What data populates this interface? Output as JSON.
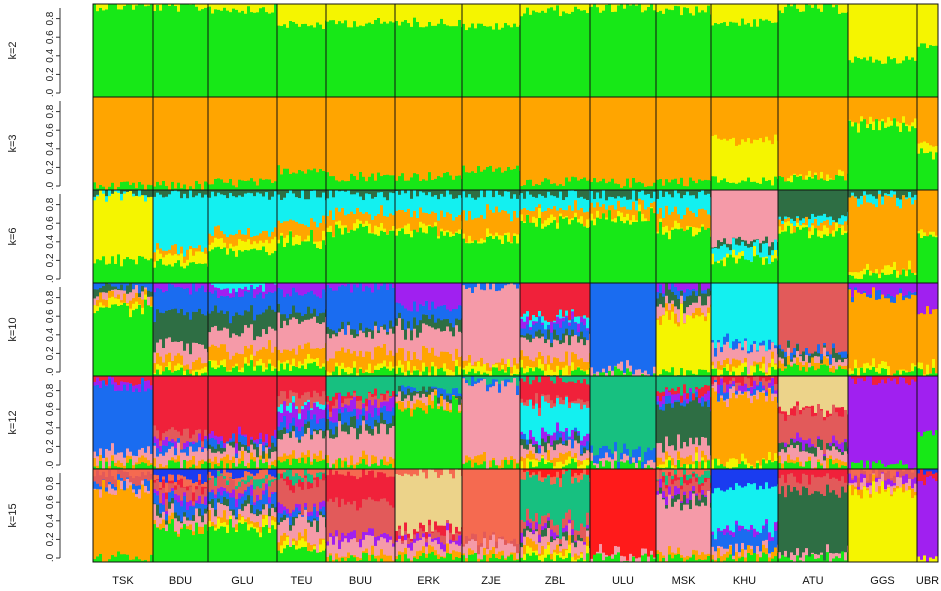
{
  "chart_data": {
    "type": "stacked-bar",
    "description_type": "admixture-structure-plot",
    "populations": [
      "TSK",
      "BDU",
      "GLU",
      "TEU",
      "BUU",
      "ERK",
      "ZJE",
      "ZBL",
      "ULU",
      "MSK",
      "KHU",
      "ATU",
      "GGS",
      "UBR"
    ],
    "ylim": [
      0,
      1
    ],
    "y_ticks": [
      ".0",
      "0.2",
      "0.4",
      "0.6",
      "0.8"
    ],
    "palette": {
      "green": "#17e817",
      "yellow": "#f5f500",
      "orange": "#ffa500",
      "cyan": "#13f0f0",
      "darkgreen": "#2e6e44",
      "pink": "#f59aa8",
      "blue": "#1a6cf0",
      "purple": "#a020f0",
      "salmon": "#e25a5a",
      "red": "#f0213a",
      "teal": "#17c080",
      "tan": "#ecd38a",
      "coral": "#f56a50",
      "brightred": "#ff1a1a",
      "navy": "#1a3cf0"
    },
    "panels": [
      {
        "label": "k=2",
        "components": [
          "green",
          "yellow"
        ],
        "values": [
          [
            0.98,
            0.02
          ],
          [
            0.97,
            0.03
          ],
          [
            0.95,
            0.05
          ],
          [
            0.78,
            0.22
          ],
          [
            0.8,
            0.2
          ],
          [
            0.8,
            0.2
          ],
          [
            0.76,
            0.24
          ],
          [
            0.93,
            0.07
          ],
          [
            0.96,
            0.04
          ],
          [
            0.93,
            0.07
          ],
          [
            0.8,
            0.2
          ],
          [
            0.95,
            0.05
          ],
          [
            0.4,
            0.6
          ],
          [
            0.55,
            0.45
          ]
        ]
      },
      {
        "label": "k=3",
        "components": [
          "green",
          "yellow",
          "orange"
        ],
        "values": [
          [
            0.04,
            0.0,
            0.96
          ],
          [
            0.05,
            0.0,
            0.95
          ],
          [
            0.08,
            0.0,
            0.92
          ],
          [
            0.22,
            0.0,
            0.78
          ],
          [
            0.15,
            0.0,
            0.85
          ],
          [
            0.15,
            0.0,
            0.85
          ],
          [
            0.22,
            0.0,
            0.78
          ],
          [
            0.1,
            0.0,
            0.9
          ],
          [
            0.08,
            0.0,
            0.92
          ],
          [
            0.1,
            0.0,
            0.9
          ],
          [
            0.1,
            0.45,
            0.45
          ],
          [
            0.12,
            0.02,
            0.86
          ],
          [
            0.7,
            0.05,
            0.25
          ],
          [
            0.4,
            0.1,
            0.5
          ]
        ]
      },
      {
        "label": "k=6",
        "components": [
          "green",
          "yellow",
          "orange",
          "cyan",
          "darkgreen",
          "pink"
        ],
        "values": [
          [
            0.25,
            0.7,
            0.0,
            0.03,
            0.02,
            0.0
          ],
          [
            0.2,
            0.1,
            0.05,
            0.6,
            0.05,
            0.0
          ],
          [
            0.35,
            0.1,
            0.1,
            0.4,
            0.05,
            0.0
          ],
          [
            0.45,
            0.05,
            0.15,
            0.3,
            0.05,
            0.0
          ],
          [
            0.55,
            0.05,
            0.15,
            0.2,
            0.05,
            0.0
          ],
          [
            0.55,
            0.05,
            0.15,
            0.2,
            0.05,
            0.0
          ],
          [
            0.45,
            0.05,
            0.25,
            0.2,
            0.05,
            0.0
          ],
          [
            0.65,
            0.05,
            0.1,
            0.15,
            0.05,
            0.0
          ],
          [
            0.7,
            0.05,
            0.1,
            0.1,
            0.05,
            0.0
          ],
          [
            0.55,
            0.05,
            0.15,
            0.2,
            0.05,
            0.0
          ],
          [
            0.25,
            0.05,
            0.0,
            0.1,
            0.05,
            0.55
          ],
          [
            0.55,
            0.05,
            0.05,
            0.05,
            0.3,
            0.0
          ],
          [
            0.1,
            0.05,
            0.75,
            0.05,
            0.05,
            0.0
          ],
          [
            0.5,
            0.05,
            0.45,
            0.0,
            0.0,
            0.0
          ]
        ]
      },
      {
        "label": "k=10",
        "components": [
          "green",
          "yellow",
          "orange",
          "pink",
          "darkgreen",
          "blue",
          "purple",
          "cyan",
          "salmon",
          "red"
        ],
        "values": [
          [
            0.75,
            0.05,
            0.05,
            0.05,
            0.05,
            0.05,
            0.0,
            0.0,
            0.0,
            0.0
          ],
          [
            0.05,
            0.05,
            0.1,
            0.15,
            0.35,
            0.25,
            0.05,
            0.0,
            0.0,
            0.0
          ],
          [
            0.1,
            0.05,
            0.15,
            0.2,
            0.2,
            0.2,
            0.05,
            0.05,
            0.0,
            0.0
          ],
          [
            0.1,
            0.05,
            0.15,
            0.3,
            0.1,
            0.2,
            0.1,
            0.0,
            0.0,
            0.0
          ],
          [
            0.05,
            0.05,
            0.15,
            0.2,
            0.05,
            0.45,
            0.05,
            0.0,
            0.0,
            0.0
          ],
          [
            0.05,
            0.05,
            0.15,
            0.25,
            0.1,
            0.15,
            0.25,
            0.0,
            0.0,
            0.0
          ],
          [
            0.05,
            0.05,
            0.05,
            0.8,
            0.0,
            0.05,
            0.0,
            0.0,
            0.0,
            0.0
          ],
          [
            0.05,
            0.05,
            0.1,
            0.2,
            0.05,
            0.1,
            0.05,
            0.05,
            0.0,
            0.35
          ],
          [
            0.05,
            0.0,
            0.0,
            0.05,
            0.0,
            0.9,
            0.0,
            0.0,
            0.0,
            0.0
          ],
          [
            0.05,
            0.6,
            0.05,
            0.1,
            0.1,
            0.05,
            0.05,
            0.0,
            0.0,
            0.0
          ],
          [
            0.05,
            0.05,
            0.05,
            0.15,
            0.0,
            0.05,
            0.0,
            0.65,
            0.0,
            0.0
          ],
          [
            0.1,
            0.0,
            0.05,
            0.05,
            0.05,
            0.05,
            0.0,
            0.0,
            0.7,
            0.0
          ],
          [
            0.05,
            0.05,
            0.75,
            0.0,
            0.0,
            0.05,
            0.1,
            0.0,
            0.0,
            0.0
          ],
          [
            0.05,
            0.05,
            0.6,
            0.0,
            0.0,
            0.0,
            0.3,
            0.0,
            0.0,
            0.0
          ]
        ]
      },
      {
        "label": "k=12",
        "components": [
          "green",
          "yellow",
          "orange",
          "pink",
          "darkgreen",
          "blue",
          "purple",
          "cyan",
          "salmon",
          "red",
          "teal",
          "tan"
        ],
        "values": [
          [
            0.05,
            0.0,
            0.05,
            0.1,
            0.0,
            0.7,
            0.05,
            0.0,
            0.0,
            0.05,
            0.0,
            0.0
          ],
          [
            0.05,
            0.0,
            0.05,
            0.1,
            0.0,
            0.05,
            0.05,
            0.0,
            0.1,
            0.6,
            0.0,
            0.0
          ],
          [
            0.05,
            0.0,
            0.05,
            0.1,
            0.05,
            0.05,
            0.05,
            0.0,
            0.0,
            0.65,
            0.0,
            0.0
          ],
          [
            0.1,
            0.0,
            0.05,
            0.2,
            0.05,
            0.1,
            0.15,
            0.05,
            0.1,
            0.2,
            0.0,
            0.0
          ],
          [
            0.05,
            0.0,
            0.05,
            0.3,
            0.1,
            0.1,
            0.1,
            0.0,
            0.05,
            0.05,
            0.2,
            0.0
          ],
          [
            0.65,
            0.0,
            0.05,
            0.05,
            0.05,
            0.05,
            0.0,
            0.0,
            0.0,
            0.0,
            0.15,
            0.0
          ],
          [
            0.05,
            0.0,
            0.05,
            0.8,
            0.0,
            0.05,
            0.0,
            0.0,
            0.0,
            0.0,
            0.05,
            0.0
          ],
          [
            0.05,
            0.05,
            0.05,
            0.1,
            0.05,
            0.05,
            0.05,
            0.3,
            0.05,
            0.2,
            0.05,
            0.0
          ],
          [
            0.05,
            0.0,
            0.0,
            0.05,
            0.0,
            0.1,
            0.0,
            0.0,
            0.0,
            0.0,
            0.8,
            0.0
          ],
          [
            0.05,
            0.05,
            0.05,
            0.15,
            0.4,
            0.05,
            0.05,
            0.0,
            0.0,
            0.05,
            0.15,
            0.0
          ],
          [
            0.05,
            0.05,
            0.65,
            0.05,
            0.0,
            0.05,
            0.05,
            0.0,
            0.05,
            0.05,
            0.0,
            0.0
          ],
          [
            0.05,
            0.0,
            0.05,
            0.1,
            0.05,
            0.0,
            0.05,
            0.0,
            0.3,
            0.05,
            0.0,
            0.35
          ],
          [
            0.05,
            0.0,
            0.0,
            0.0,
            0.0,
            0.0,
            0.9,
            0.0,
            0.0,
            0.05,
            0.0,
            0.0
          ],
          [
            0.4,
            0.0,
            0.0,
            0.0,
            0.0,
            0.0,
            0.6,
            0.0,
            0.0,
            0.0,
            0.0,
            0.0
          ]
        ]
      },
      {
        "label": "k=15",
        "components": [
          "green",
          "yellow",
          "orange",
          "pink",
          "darkgreen",
          "blue",
          "purple",
          "cyan",
          "salmon",
          "red",
          "teal",
          "tan",
          "coral",
          "brightred",
          "navy"
        ],
        "values": [
          [
            0.05,
            0.0,
            0.7,
            0.05,
            0.0,
            0.05,
            0.0,
            0.0,
            0.1,
            0.0,
            0.0,
            0.0,
            0.05,
            0.0,
            0.0
          ],
          [
            0.35,
            0.0,
            0.05,
            0.1,
            0.05,
            0.1,
            0.05,
            0.0,
            0.1,
            0.05,
            0.0,
            0.0,
            0.05,
            0.0,
            0.1
          ],
          [
            0.35,
            0.05,
            0.05,
            0.1,
            0.05,
            0.1,
            0.05,
            0.0,
            0.1,
            0.0,
            0.05,
            0.0,
            0.05,
            0.0,
            0.05
          ],
          [
            0.15,
            0.05,
            0.05,
            0.2,
            0.05,
            0.05,
            0.05,
            0.0,
            0.25,
            0.05,
            0.05,
            0.0,
            0.05,
            0.0,
            0.0
          ],
          [
            0.05,
            0.0,
            0.05,
            0.15,
            0.0,
            0.0,
            0.05,
            0.0,
            0.35,
            0.3,
            0.0,
            0.0,
            0.05,
            0.0,
            0.0
          ],
          [
            0.05,
            0.0,
            0.05,
            0.1,
            0.0,
            0.0,
            0.05,
            0.0,
            0.05,
            0.05,
            0.0,
            0.6,
            0.05,
            0.0,
            0.0
          ],
          [
            0.05,
            0.0,
            0.05,
            0.1,
            0.0,
            0.0,
            0.0,
            0.0,
            0.05,
            0.0,
            0.0,
            0.0,
            0.75,
            0.0,
            0.0
          ],
          [
            0.05,
            0.05,
            0.05,
            0.1,
            0.05,
            0.0,
            0.05,
            0.0,
            0.1,
            0.0,
            0.45,
            0.0,
            0.05,
            0.05,
            0.0
          ],
          [
            0.05,
            0.0,
            0.0,
            0.05,
            0.0,
            0.0,
            0.0,
            0.0,
            0.0,
            0.0,
            0.0,
            0.0,
            0.0,
            0.9,
            0.0
          ],
          [
            0.05,
            0.0,
            0.05,
            0.55,
            0.05,
            0.0,
            0.05,
            0.0,
            0.1,
            0.05,
            0.05,
            0.0,
            0.05,
            0.0,
            0.0
          ],
          [
            0.05,
            0.0,
            0.05,
            0.05,
            0.0,
            0.15,
            0.05,
            0.45,
            0.0,
            0.0,
            0.0,
            0.0,
            0.0,
            0.0,
            0.2
          ],
          [
            0.05,
            0.0,
            0.0,
            0.05,
            0.65,
            0.0,
            0.0,
            0.0,
            0.15,
            0.1,
            0.0,
            0.0,
            0.0,
            0.0,
            0.0
          ],
          [
            0.0,
            0.75,
            0.05,
            0.05,
            0.0,
            0.0,
            0.05,
            0.0,
            0.05,
            0.0,
            0.0,
            0.0,
            0.05,
            0.0,
            0.0
          ],
          [
            0.0,
            0.05,
            0.0,
            0.0,
            0.0,
            0.0,
            0.8,
            0.0,
            0.0,
            0.1,
            0.0,
            0.0,
            0.0,
            0.0,
            0.05
          ]
        ]
      }
    ]
  }
}
